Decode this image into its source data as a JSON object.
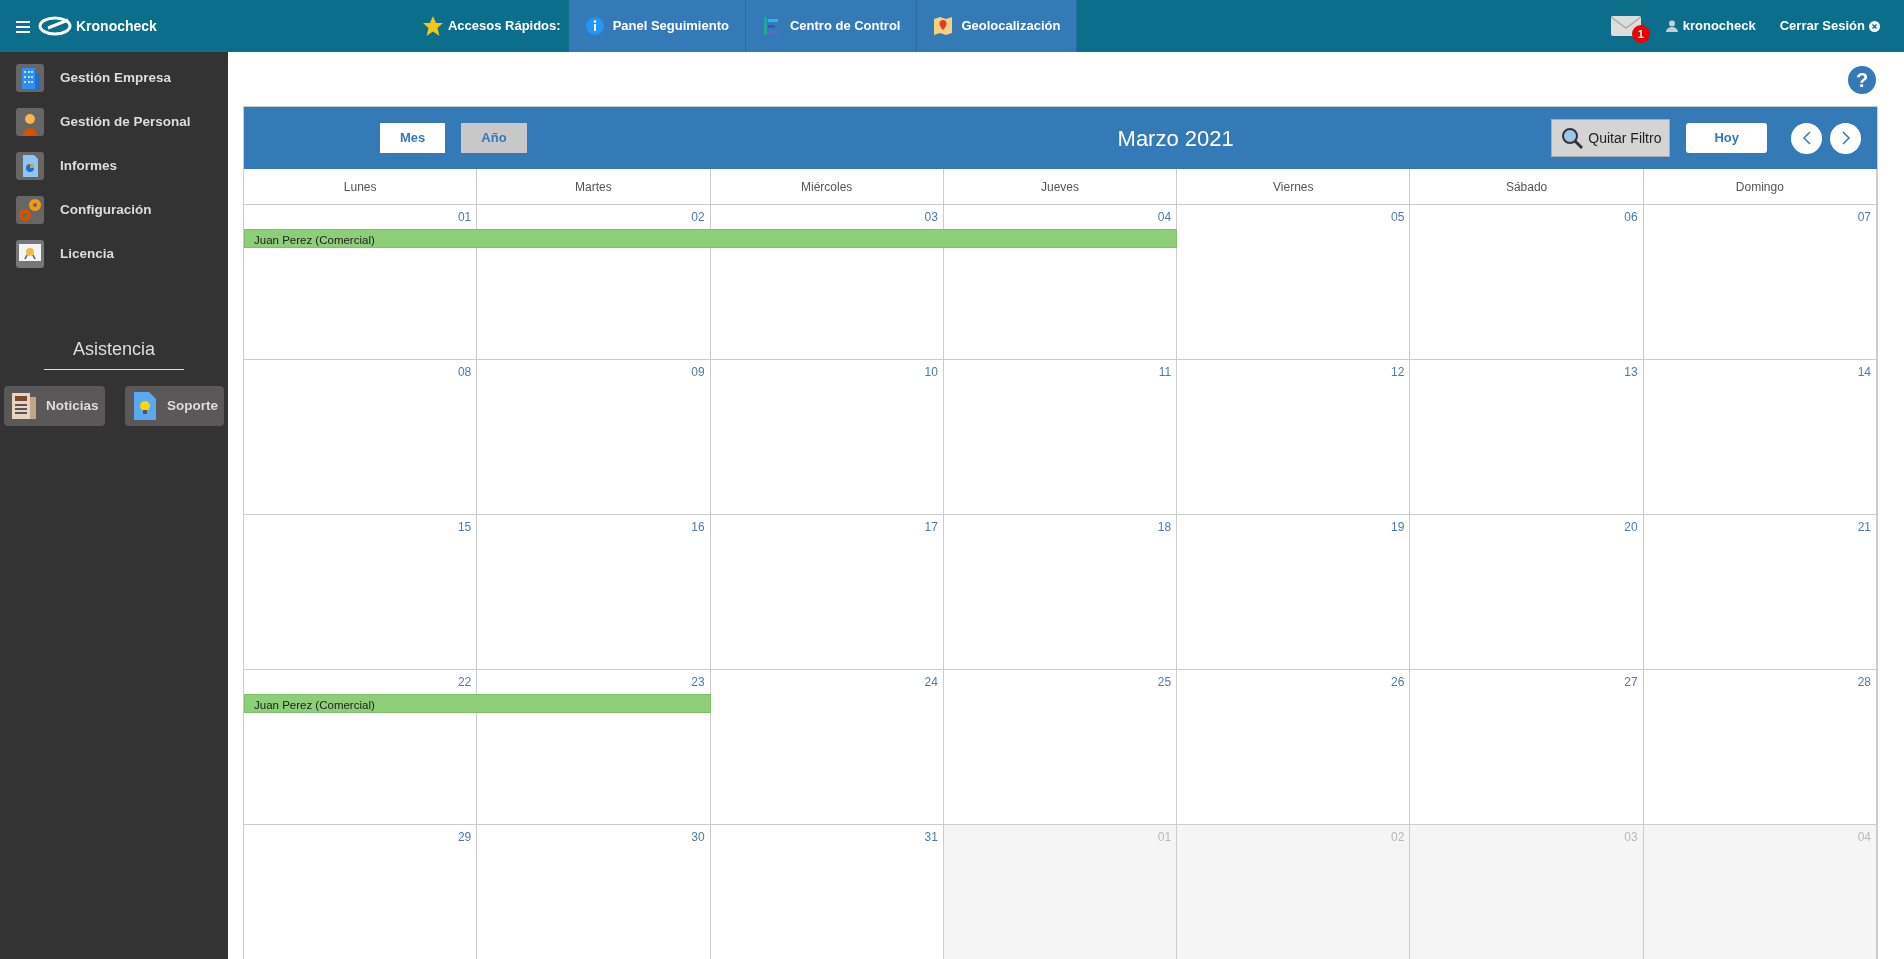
{
  "topbar": {
    "brand": "Kronocheck",
    "quick_access_label": "Accesos Rápidos:",
    "quick_links": [
      {
        "label": "Panel Seguimiento",
        "kind": "info"
      },
      {
        "label": "Centro de Control",
        "kind": "control"
      },
      {
        "label": "Geolocalización",
        "kind": "map"
      }
    ],
    "mail_badge": "1",
    "user": "kronocheck",
    "logout": "Cerrar Sesión"
  },
  "sidebar": {
    "items": [
      {
        "label": "Gestión Empresa",
        "kind": "building"
      },
      {
        "label": "Gestión de Personal",
        "kind": "person"
      },
      {
        "label": "Informes",
        "kind": "report"
      },
      {
        "label": "Configuración",
        "kind": "gears"
      },
      {
        "label": "Licencia",
        "kind": "certificate"
      }
    ],
    "section_title": "Asistencia",
    "buttons": [
      {
        "label": "Noticias",
        "kind": "news"
      },
      {
        "label": "Soporte",
        "kind": "bulb"
      }
    ]
  },
  "help": "?",
  "calendar": {
    "view_buttons": [
      {
        "label": "Mes",
        "selected": true
      },
      {
        "label": "Año",
        "selected": false
      }
    ],
    "title": "Marzo 2021",
    "filter_button": "Quitar Filtro",
    "today_button": "Hoy",
    "weekdays": [
      "Lunes",
      "Martes",
      "Miércoles",
      "Jueves",
      "Viernes",
      "Sábado",
      "Domingo"
    ],
    "weeks": [
      {
        "days": [
          {
            "label": "01",
            "other_month": false,
            "event": "Juan Perez (Comercial)"
          },
          {
            "label": "02",
            "other_month": false,
            "event_continues": true
          },
          {
            "label": "03",
            "other_month": false,
            "event_continues": true
          },
          {
            "label": "04",
            "other_month": false,
            "event_continues": true
          },
          {
            "label": "05",
            "other_month": false
          },
          {
            "label": "06",
            "other_month": false
          },
          {
            "label": "07",
            "other_month": false
          }
        ]
      },
      {
        "days": [
          {
            "label": "08",
            "other_month": false
          },
          {
            "label": "09",
            "other_month": false
          },
          {
            "label": "10",
            "other_month": false
          },
          {
            "label": "11",
            "other_month": false
          },
          {
            "label": "12",
            "other_month": false
          },
          {
            "label": "13",
            "other_month": false
          },
          {
            "label": "14",
            "other_month": false
          }
        ]
      },
      {
        "days": [
          {
            "label": "15",
            "other_month": false
          },
          {
            "label": "16",
            "other_month": false
          },
          {
            "label": "17",
            "other_month": false
          },
          {
            "label": "18",
            "other_month": false
          },
          {
            "label": "19",
            "other_month": false
          },
          {
            "label": "20",
            "other_month": false
          },
          {
            "label": "21",
            "other_month": false
          }
        ]
      },
      {
        "days": [
          {
            "label": "22",
            "other_month": false,
            "event": "Juan Perez (Comercial)"
          },
          {
            "label": "23",
            "other_month": false,
            "event_continues": true
          },
          {
            "label": "24",
            "other_month": false
          },
          {
            "label": "25",
            "other_month": false
          },
          {
            "label": "26",
            "other_month": false
          },
          {
            "label": "27",
            "other_month": false
          },
          {
            "label": "28",
            "other_month": false
          }
        ]
      },
      {
        "days": [
          {
            "label": "29",
            "other_month": false
          },
          {
            "label": "30",
            "other_month": false
          },
          {
            "label": "31",
            "other_month": false
          },
          {
            "label": "01",
            "other_month": true
          },
          {
            "label": "02",
            "other_month": true
          },
          {
            "label": "03",
            "other_month": true
          },
          {
            "label": "04",
            "other_month": true
          }
        ]
      }
    ]
  }
}
